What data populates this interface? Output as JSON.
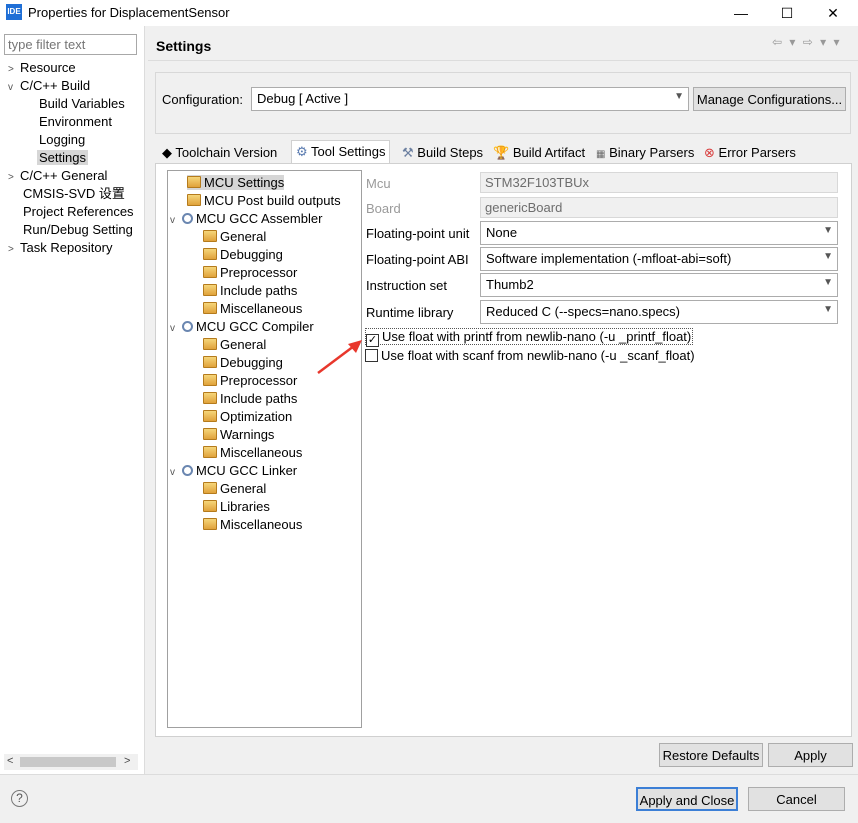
{
  "window": {
    "title": "Properties for DisplacementSensor",
    "logo": "IDE",
    "minimize": "—",
    "maximize": "☐",
    "close": "✕"
  },
  "filter": {
    "placeholder": "type filter text"
  },
  "nav": {
    "resource": "Resource",
    "cc_build": "C/C++ Build",
    "build_variables": "Build Variables",
    "environment": "Environment",
    "logging": "Logging",
    "settings": "Settings",
    "cc_general": "C/C++ General",
    "cmsis": "CMSIS-SVD 设置",
    "project_refs": "Project References",
    "run_debug": "Run/Debug Setting",
    "task_repo": "Task Repository"
  },
  "settings": {
    "title": "Settings",
    "history": "⇦ ▾ ⇨ ▾ ▾",
    "config_label": "Configuration:",
    "config_value": "Debug  [ Active ]",
    "manage_btn": "Manage Configurations..."
  },
  "tabs": {
    "toolchain": "Toolchain  Version",
    "tool_settings": "Tool Settings",
    "build_steps": "Build Steps",
    "build_artifact": "Build Artifact",
    "binary_parsers": "Binary Parsers",
    "error_parsers": "Error Parsers"
  },
  "tree": {
    "mcu_settings": "MCU Settings",
    "post_build": "MCU Post build outputs",
    "assembler": "MCU GCC Assembler",
    "asm_general": "General",
    "asm_debugging": "Debugging",
    "asm_preprocessor": "Preprocessor",
    "asm_include": "Include paths",
    "asm_misc": "Miscellaneous",
    "compiler": "MCU GCC Compiler",
    "cc_general": "General",
    "cc_debugging": "Debugging",
    "cc_preprocessor": "Preprocessor",
    "cc_include": "Include paths",
    "cc_optimization": "Optimization",
    "cc_warnings": "Warnings",
    "cc_misc": "Miscellaneous",
    "linker": "MCU GCC Linker",
    "ld_general": "General",
    "ld_libraries": "Libraries",
    "ld_misc": "Miscellaneous"
  },
  "form": {
    "mcu_label": "Mcu",
    "mcu_value": "STM32F103TBUx",
    "board_label": "Board",
    "board_value": "genericBoard",
    "fpu_label": "Floating-point unit",
    "fpu_value": "None",
    "fpabi_label": "Floating-point ABI",
    "fpabi_value": "Software implementation (-mfloat-abi=soft)",
    "iset_label": "Instruction set",
    "iset_value": "Thumb2",
    "rtlib_label": "Runtime library",
    "rtlib_value": "Reduced C (--specs=nano.specs)",
    "printf_label": "Use float with printf from newlib-nano (-u _printf_float)",
    "printf_checked": true,
    "scanf_label": "Use float with scanf from newlib-nano (-u _scanf_float)",
    "scanf_checked": false
  },
  "buttons": {
    "restore_defaults": "Restore Defaults",
    "apply": "Apply",
    "apply_close": "Apply and Close",
    "cancel": "Cancel"
  },
  "help_icon": "?",
  "accent_color": "#e8372c"
}
